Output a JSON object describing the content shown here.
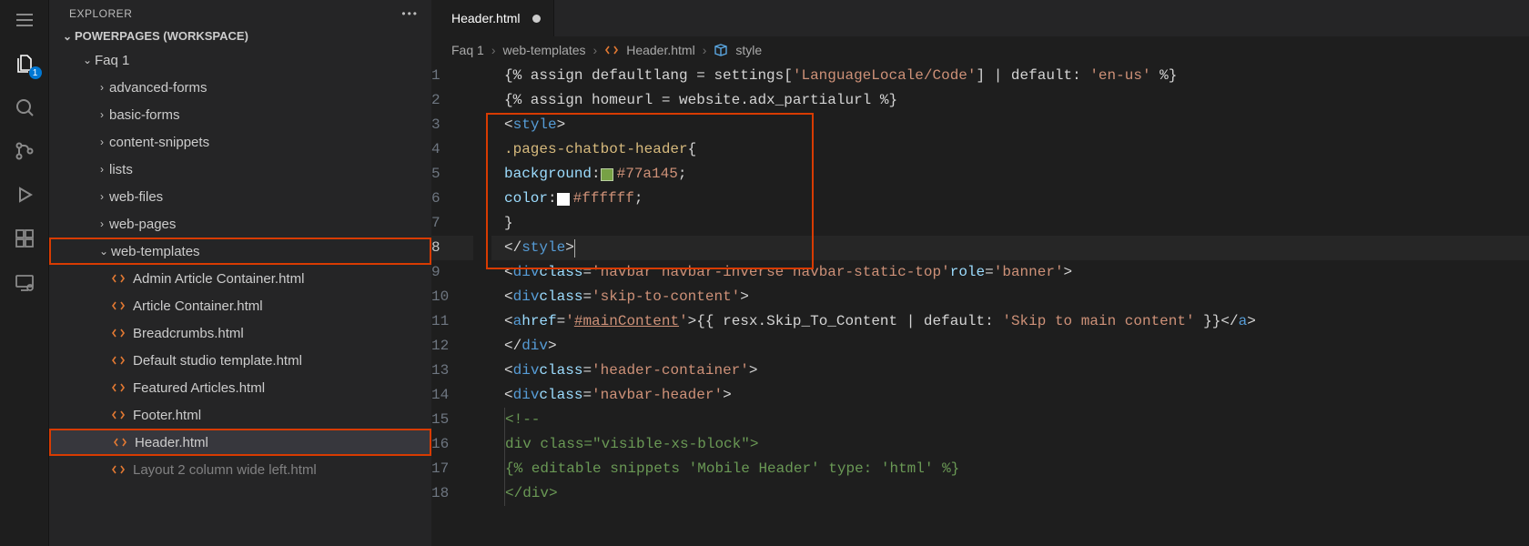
{
  "activityBar": {
    "items": [
      {
        "name": "menu-icon",
        "glyph": "menu"
      },
      {
        "name": "files-icon",
        "glyph": "files",
        "active": true,
        "badge": "1"
      },
      {
        "name": "search-icon",
        "glyph": "search"
      },
      {
        "name": "source-control-icon",
        "glyph": "branch"
      },
      {
        "name": "debug-icon",
        "glyph": "debug"
      },
      {
        "name": "extensions-icon",
        "glyph": "extensions"
      },
      {
        "name": "remote-explorer-icon",
        "glyph": "remote"
      }
    ]
  },
  "sidebar": {
    "title": "EXPLORER",
    "workspaceLabel": "POWERPAGES (WORKSPACE)",
    "tree": [
      {
        "label": "Faq 1",
        "type": "folder",
        "expanded": true,
        "depth": 1
      },
      {
        "label": "advanced-forms",
        "type": "folder",
        "expanded": false,
        "depth": 2
      },
      {
        "label": "basic-forms",
        "type": "folder",
        "expanded": false,
        "depth": 2
      },
      {
        "label": "content-snippets",
        "type": "folder",
        "expanded": false,
        "depth": 2
      },
      {
        "label": "lists",
        "type": "folder",
        "expanded": false,
        "depth": 2
      },
      {
        "label": "web-files",
        "type": "folder",
        "expanded": false,
        "depth": 2
      },
      {
        "label": "web-pages",
        "type": "folder",
        "expanded": false,
        "depth": 2
      },
      {
        "label": "web-templates",
        "type": "folder",
        "expanded": true,
        "depth": 2,
        "highlight": true
      },
      {
        "label": "Admin Article Container.html",
        "type": "file",
        "depth": 3
      },
      {
        "label": "Article Container.html",
        "type": "file",
        "depth": 3
      },
      {
        "label": "Breadcrumbs.html",
        "type": "file",
        "depth": 3
      },
      {
        "label": "Default studio template.html",
        "type": "file",
        "depth": 3
      },
      {
        "label": "Featured Articles.html",
        "type": "file",
        "depth": 3
      },
      {
        "label": "Footer.html",
        "type": "file",
        "depth": 3
      },
      {
        "label": "Header.html",
        "type": "file",
        "depth": 3,
        "selected": true,
        "highlight": true
      },
      {
        "label": "Layout 2 column wide left.html",
        "type": "file",
        "depth": 3,
        "cut": true
      }
    ]
  },
  "tabs": [
    {
      "label": "Header.html",
      "modified": true
    }
  ],
  "breadcrumbs": [
    {
      "label": "Faq 1",
      "icon": null
    },
    {
      "label": "web-templates",
      "icon": null
    },
    {
      "label": "Header.html",
      "icon": "html"
    },
    {
      "label": "style",
      "icon": "symbol"
    }
  ],
  "code": {
    "lines": [
      "{% assign defaultlang = settings['LanguageLocale/Code'] | default: 'en-us' %}",
      "{% assign homeurl = website.adx_partialurl %}",
      "<style>",
      "  .pages-chatbot-header {",
      "    background: #77a145;",
      "    color: #ffffff;",
      "  }",
      "</style>",
      "<div class='navbar navbar-inverse navbar-static-top' role='banner'>",
      "  <div class='skip-to-content'>",
      "    <a href='#mainContent'>{{ resx.Skip_To_Content | default: 'Skip to main content' }}</a>",
      "  </div>",
      "  <div class='header-container'>",
      "    <div class='navbar-header'>",
      "      <!--",
      "      div class=\"visible-xs-block\">",
      "        {% editable snippets 'Mobile Header' type: 'html' %}",
      "      </div>"
    ],
    "activeLine": 8,
    "swatch1": "#77a145",
    "swatch2": "#ffffff"
  }
}
